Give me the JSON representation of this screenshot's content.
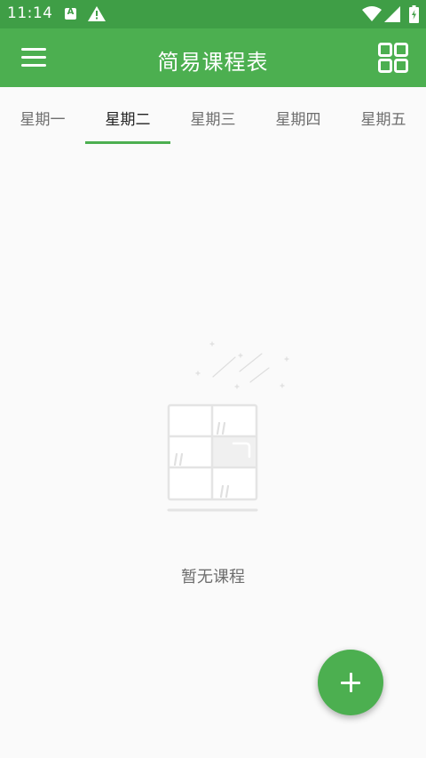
{
  "status_bar": {
    "time": "11:14",
    "notification_letter": "A",
    "icons": [
      "a-notification-icon",
      "warning-icon",
      "wifi-icon",
      "signal-icon",
      "battery-charging-icon"
    ],
    "background_color": "#3f9e46"
  },
  "app_bar": {
    "title": "简易课程表",
    "menu_icon": "hamburger-menu-icon",
    "grid_icon": "grid-view-icon",
    "background_color": "#4caf50"
  },
  "tabs": [
    {
      "label": "星期一",
      "selected": false
    },
    {
      "label": "星期二",
      "selected": true
    },
    {
      "label": "星期三",
      "selected": false
    },
    {
      "label": "星期四",
      "selected": false
    },
    {
      "label": "星期五",
      "selected": false
    }
  ],
  "empty_state": {
    "message": "暂无课程",
    "illustration_icon": "empty-bookshelf-illustration"
  },
  "fab": {
    "icon": "plus-icon",
    "color": "#4caf50"
  },
  "accent_color": "#4caf50"
}
